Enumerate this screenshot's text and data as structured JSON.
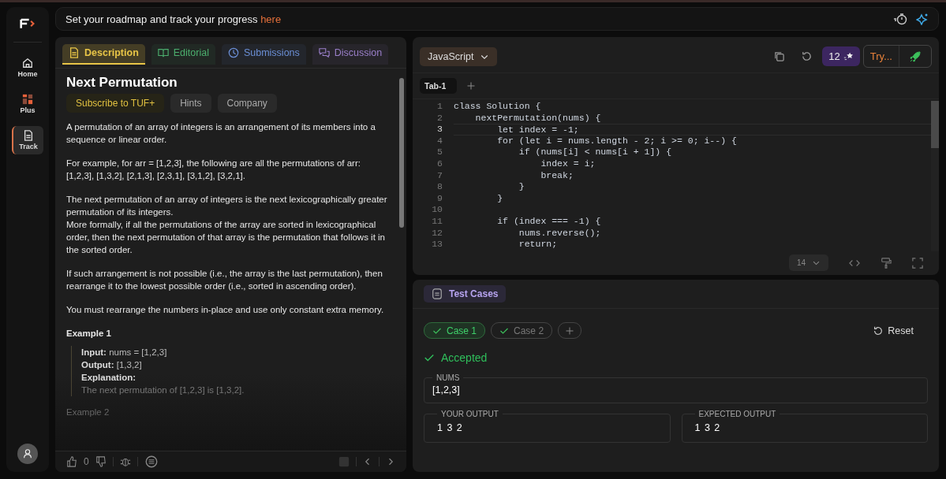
{
  "sidebar": {
    "items": [
      {
        "label": "Home",
        "selected": false
      },
      {
        "label": "Plus",
        "selected": false
      },
      {
        "label": "Track",
        "selected": true
      }
    ]
  },
  "banner": {
    "text": "Set your roadmap and track your progress",
    "link": "here"
  },
  "problem": {
    "tabs": [
      {
        "label": "Description",
        "color": "#e8c547",
        "selected": true
      },
      {
        "label": "Editorial",
        "color": "#4caf6e",
        "selected": false
      },
      {
        "label": "Submissions",
        "color": "#6b8fd6",
        "selected": false
      },
      {
        "label": "Discussion",
        "color": "#9a7fc9",
        "selected": false
      }
    ],
    "title": "Next Permutation",
    "chips": [
      {
        "label": "Subscribe to TUF+",
        "kind": "premium"
      },
      {
        "label": "Hints",
        "kind": "plain"
      },
      {
        "label": "Company",
        "kind": "plain"
      }
    ],
    "paragraphs": [
      [
        "A permutation of an array of integers is an arrangement of its members into a sequence or linear order."
      ],
      [
        "For example, for arr = [1,2,3], the following are all the permutations of arr: [1,2,3], [1,3,2], [2,1,3], [2,3,1], [3,1,2], [3,2,1]."
      ],
      [
        "The next permutation of an array of integers is the next lexicographically greater permutation of its integers.",
        "More formally, if all the permutations of the array are sorted in lexicographical order, then the next permutation of that array is the permutation that follows it in the sorted order."
      ],
      [
        "If such arrangement is not possible (i.e., the array is the last permutation), then rearrange it to the lowest possible order (i.e., sorted in ascending order)."
      ],
      [
        "You must rearrange the numbers in-place and use only constant extra memory."
      ]
    ],
    "example": {
      "title": "Example 1",
      "lines": [
        "**Input:** nums = [1,2,3]",
        "**Output:** [1,3,2]",
        "**Explanation:**",
        "The next permutation of [1,2,3] is [1,3,2]."
      ]
    },
    "next_example": "Example 2",
    "likes": "0"
  },
  "editor": {
    "language": "JavaScript",
    "credits": "12",
    "try_label": "Try...",
    "tabs": [
      {
        "label": "Tab-1",
        "selected": true
      }
    ],
    "lines": [
      {
        "number": "1",
        "code": "class Solution {"
      },
      {
        "number": "2",
        "code": "    nextPermutation(nums) {"
      },
      {
        "number": "3",
        "code": "        let index = -1;"
      },
      {
        "number": "4",
        "code": "        for (let i = nums.length - 2; i >= 0; i--) {"
      },
      {
        "number": "5",
        "code": "            if (nums[i] < nums[i + 1]) {"
      },
      {
        "number": "6",
        "code": "                index = i;"
      },
      {
        "number": "7",
        "code": "                break;"
      },
      {
        "number": "8",
        "code": "            }"
      },
      {
        "number": "9",
        "code": "        }"
      },
      {
        "number": "10"
      },
      {
        "number": "11",
        "code": "        if (index === -1) {"
      },
      {
        "number": "12",
        "code": "            nums.reverse();"
      },
      {
        "number": "13",
        "code": "            return;"
      }
    ],
    "font_size": "14"
  },
  "tests": {
    "tab": "Test Cases",
    "cases": [
      {
        "label": "Case 1",
        "selected": true
      },
      {
        "label": "Case 2",
        "selected": false
      }
    ],
    "reset": "Reset",
    "status": "Accepted",
    "input": {
      "label": "NUMS",
      "value": "[1,2,3]"
    },
    "your_output": {
      "label": "YOUR OUTPUT",
      "value": "1 3 2"
    },
    "expected_output": {
      "label": "EXPECTED OUTPUT",
      "value": "1 3 2"
    }
  }
}
